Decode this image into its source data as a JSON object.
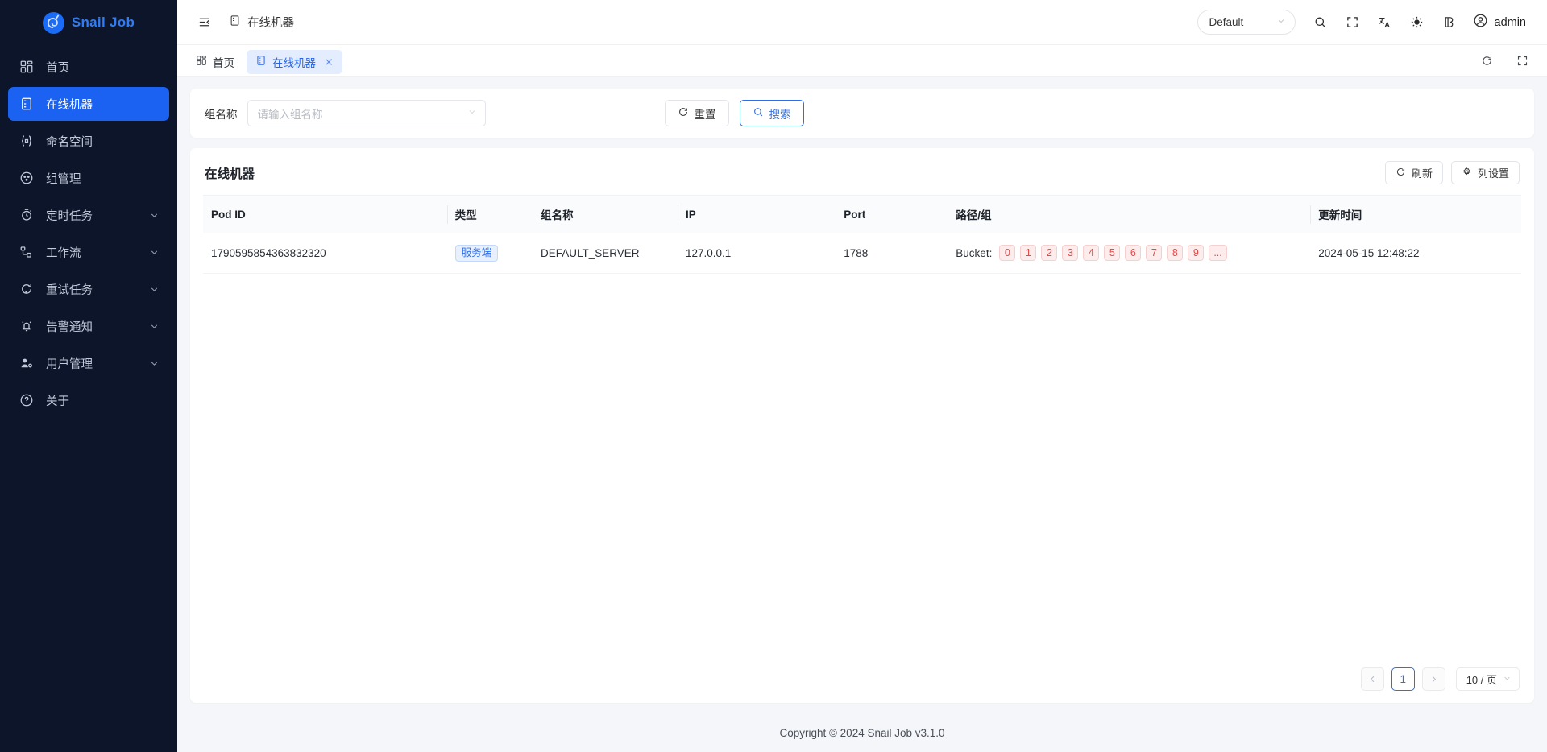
{
  "brand": {
    "name": "Snail Job",
    "logo_icon": "snail-logo-icon"
  },
  "sidebar": {
    "items": [
      {
        "label": "首页",
        "icon": "dashboard-icon",
        "active": false,
        "expandable": false
      },
      {
        "label": "在线机器",
        "icon": "server-icon",
        "active": true,
        "expandable": false
      },
      {
        "label": "命名空间",
        "icon": "namespace-icon",
        "active": false,
        "expandable": false
      },
      {
        "label": "组管理",
        "icon": "group-icon",
        "active": false,
        "expandable": false
      },
      {
        "label": "定时任务",
        "icon": "timer-icon",
        "active": false,
        "expandable": true
      },
      {
        "label": "工作流",
        "icon": "workflow-icon",
        "active": false,
        "expandable": true
      },
      {
        "label": "重试任务",
        "icon": "retry-icon",
        "active": false,
        "expandable": true
      },
      {
        "label": "告警通知",
        "icon": "bell-icon",
        "active": false,
        "expandable": true
      },
      {
        "label": "用户管理",
        "icon": "user-settings-icon",
        "active": false,
        "expandable": true
      },
      {
        "label": "关于",
        "icon": "question-icon",
        "active": false,
        "expandable": false
      }
    ]
  },
  "topbar": {
    "collapse_icon": "menu-collapse-icon",
    "breadcrumb": "在线机器",
    "breadcrumb_icon": "server-icon",
    "namespace_select": {
      "value": "Default",
      "icon": "chevron-down-icon"
    },
    "icons": [
      "search-icon",
      "fullscreen-icon",
      "translate-icon",
      "theme-sun-icon",
      "theme-layout-icon"
    ],
    "user": {
      "name": "admin",
      "avatar_icon": "user-circle-icon"
    }
  },
  "tabbar": {
    "tabs": [
      {
        "label": "首页",
        "icon": "dashboard-icon",
        "active": false,
        "closable": false
      },
      {
        "label": "在线机器",
        "icon": "server-icon",
        "active": true,
        "closable": true
      }
    ],
    "reload_icon": "reload-icon",
    "fullscreen_icon": "fullscreen-icon"
  },
  "filter": {
    "group_label": "组名称",
    "group_placeholder": "请输入组名称",
    "group_value": "",
    "reset_label": "重置",
    "reset_icon": "reload-icon",
    "search_label": "搜索",
    "search_icon": "search-icon"
  },
  "table": {
    "title": "在线机器",
    "refresh_label": "刷新",
    "refresh_icon": "reload-icon",
    "column_settings_label": "列设置",
    "column_settings_icon": "gear-icon",
    "columns": [
      "Pod ID",
      "类型",
      "组名称",
      "IP",
      "Port",
      "路径/组",
      "更新时间"
    ],
    "rows": [
      {
        "pod_id": "1790595854363832320",
        "type": "服务端",
        "group_name": "DEFAULT_SERVER",
        "ip": "127.0.0.1",
        "port": "1788",
        "bucket_label": "Bucket:",
        "buckets": [
          "0",
          "1",
          "2",
          "3",
          "4",
          "5",
          "6",
          "7",
          "8",
          "9",
          "..."
        ],
        "update_time": "2024-05-15 12:48:22"
      }
    ]
  },
  "pagination": {
    "prev_icon": "chevron-left-icon",
    "next_icon": "chevron-right-icon",
    "current_page": "1",
    "page_size": "10 / 页"
  },
  "footer": {
    "copyright": "Copyright © 2024 Snail Job v3.1.0"
  },
  "colors": {
    "accent": "#1b62f2",
    "tag_blue": "#2f6fe4",
    "tag_red": "#e04a4a",
    "sidebar_bg": "#0c1529"
  }
}
